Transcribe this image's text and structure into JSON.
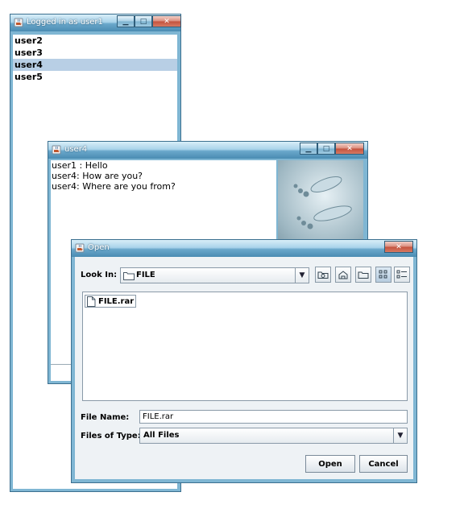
{
  "user_window": {
    "title": "Logged in as user1",
    "users": [
      "user2",
      "user3",
      "user4",
      "user5"
    ],
    "selected_user": "user4"
  },
  "chat_window": {
    "title": "user4",
    "messages": [
      "user1 : Hello",
      "user4: How are you?",
      "user4: Where are you from?"
    ]
  },
  "open_dialog": {
    "title": "Open",
    "look_in_label": "Look In:",
    "look_in_value": "FILE",
    "files": [
      "FILE.rar"
    ],
    "file_name_label": "File Name:",
    "file_name_value": "FILE.rar",
    "files_of_type_label": "Files of Type:",
    "files_of_type_value": "All Files",
    "open_button": "Open",
    "cancel_button": "Cancel"
  },
  "titlebar_buttons": {
    "minimize_icon": "minimize-icon",
    "maximize_icon": "maximize-icon",
    "close_icon": "close-icon"
  },
  "colors": {
    "window_frame": "#7fb6d3",
    "selection": "#b8cfe5"
  }
}
